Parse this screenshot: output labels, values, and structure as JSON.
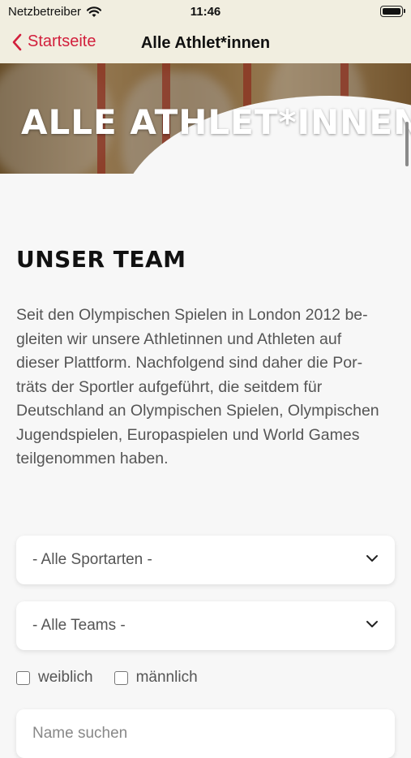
{
  "status_bar": {
    "carrier": "Netzbetreiber",
    "time": "11:46"
  },
  "nav": {
    "back_label": "Startseite",
    "title": "Alle Athlet*innen"
  },
  "hero": {
    "title": "ALLE ATHLET*INNEN"
  },
  "section": {
    "heading": "UNSER TEAM",
    "intro_lines": [
      "Seit den Olympischen Spielen in London 2012 be-",
      "gleiten wir unsere Athletinnen und Athleten auf",
      "dieser Plattform. Nachfolgend sind daher die Por-",
      "träts der Sportler aufgeführt, die seitdem für",
      "Deutschland an Olympischen Spielen, Olympischen",
      "Jugendspielen, Europaspielen und World Games",
      "teilgenommen haben."
    ]
  },
  "filters": {
    "sport_select": "- Alle Sportarten -",
    "team_select": "- Alle Teams -",
    "female_label": "weiblich",
    "male_label": "männlich",
    "search_placeholder": "Name suchen"
  },
  "colors": {
    "accent": "#d21f3c",
    "bar_background": "#f1eee0",
    "page_background": "#f7f7f7"
  },
  "icons": [
    "wifi-icon",
    "battery-icon",
    "chevron-left-icon",
    "chevron-down-icon",
    "checkbox-icon"
  ]
}
